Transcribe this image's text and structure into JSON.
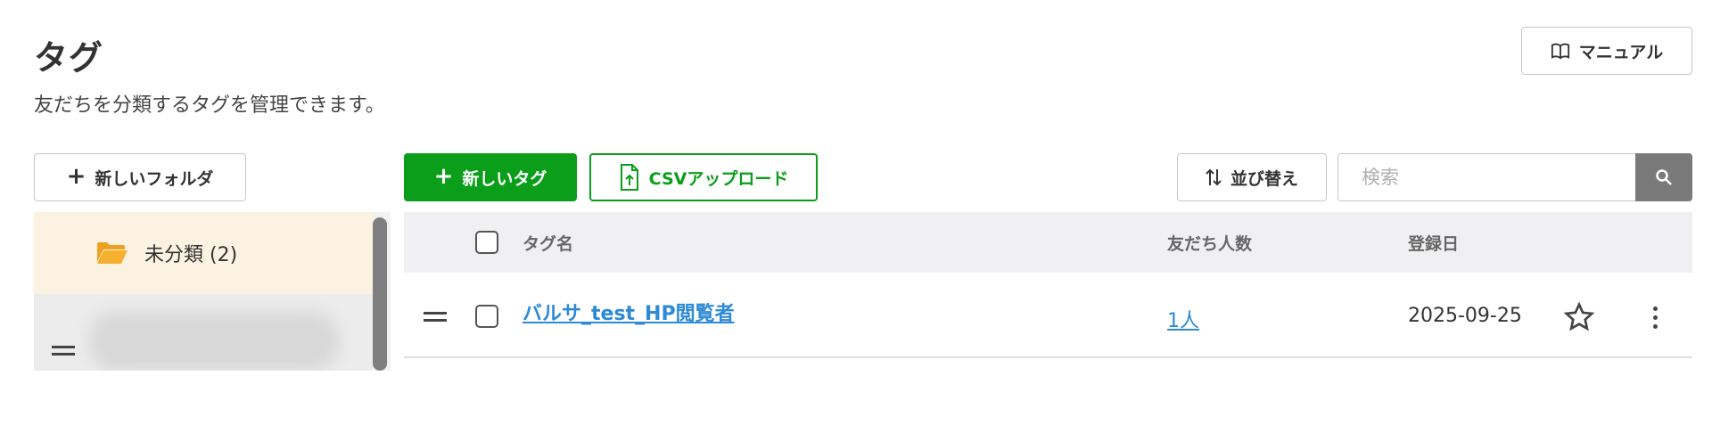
{
  "header": {
    "title": "タグ",
    "description": "友だちを分類するタグを管理できます。",
    "manual_label": "マニュアル"
  },
  "toolbar": {
    "new_folder_label": "新しいフォルダ",
    "new_tag_label": "新しいタグ",
    "csv_upload_label": "CSVアップロード",
    "sort_label": "並び替え",
    "search_placeholder": "検索"
  },
  "folders": {
    "active": {
      "label": "未分類 (2)"
    }
  },
  "table": {
    "columns": {
      "tag_name": "タグ名",
      "friend_count": "友だち人数",
      "registered_date": "登録日"
    },
    "rows": [
      {
        "tag_name": "バルサ_test_HP閲覧者",
        "friend_count": "1人",
        "registered_date": "2025-09-25"
      }
    ]
  },
  "colors": {
    "primary_green": "#0a9e1a",
    "link_blue": "#2d8ad6",
    "folder_orange": "#f0a020",
    "active_folder_bg": "#fcf2e1"
  },
  "icons": {
    "manual": "book-icon",
    "new_folder": "plus-icon",
    "new_tag": "plus-icon",
    "csv": "file-upload-icon",
    "sort": "sort-arrows-icon",
    "search": "search-icon",
    "folder": "folder-open-icon",
    "star": "star-outline-icon",
    "more": "more-vertical-icon",
    "drag": "drag-handle-icon"
  }
}
